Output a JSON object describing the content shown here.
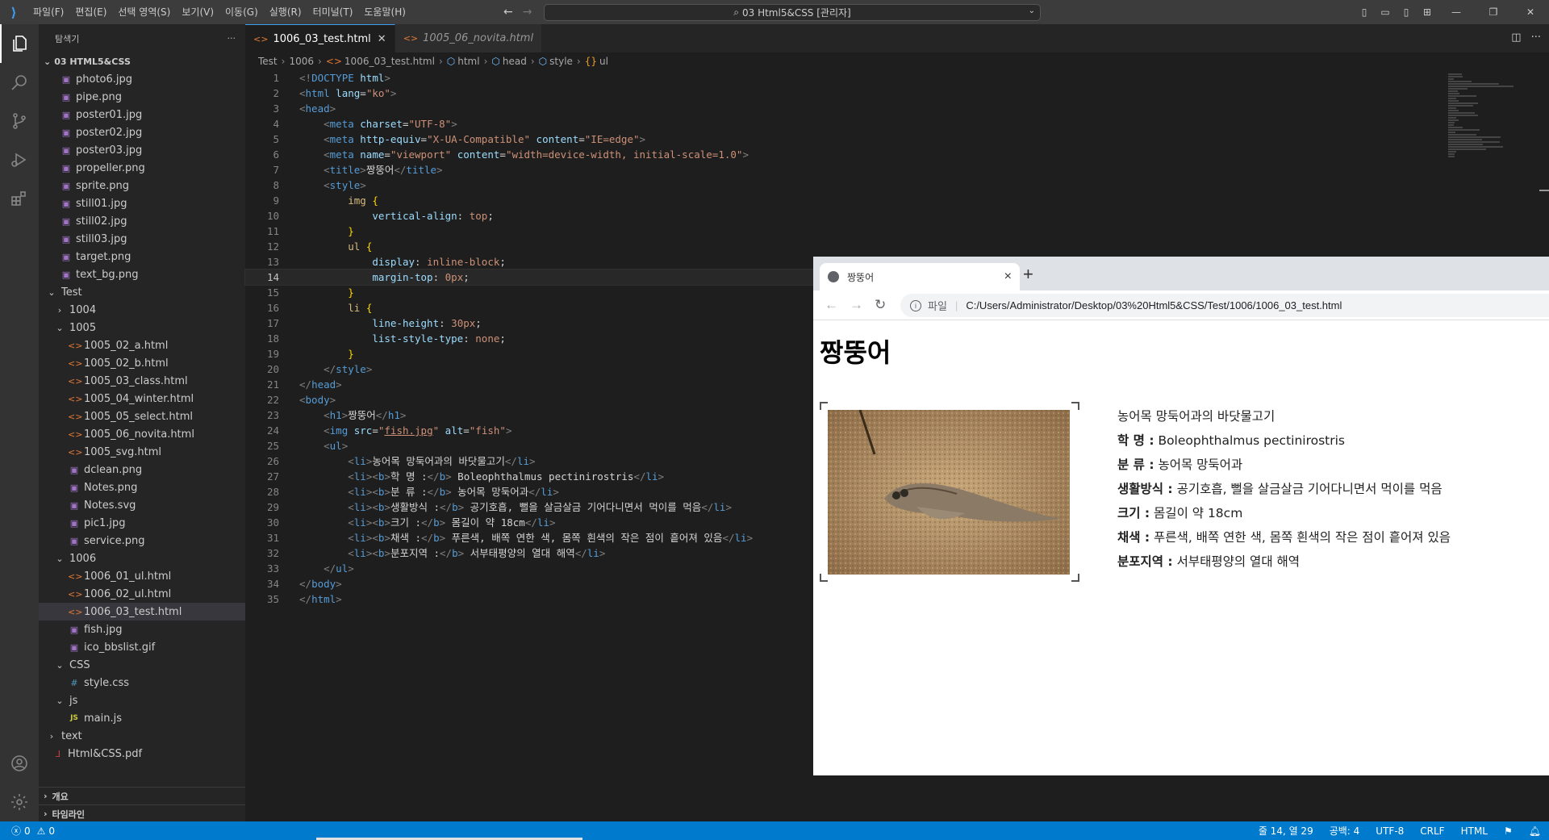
{
  "titlebar": {
    "menus": [
      "파일(F)",
      "편집(E)",
      "선택 영역(S)",
      "보기(V)",
      "이동(G)",
      "실행(R)",
      "터미널(T)",
      "도움말(H)"
    ],
    "command_center": "03 Html5&CSS [관리자]"
  },
  "explorer": {
    "title": "탐색기",
    "root": "03 HTML5&CSS",
    "items": [
      {
        "label": "photo6.jpg",
        "icon": "image",
        "indent": 1
      },
      {
        "label": "pipe.png",
        "icon": "image",
        "indent": 1
      },
      {
        "label": "poster01.jpg",
        "icon": "image",
        "indent": 1
      },
      {
        "label": "poster02.jpg",
        "icon": "image",
        "indent": 1
      },
      {
        "label": "poster03.jpg",
        "icon": "image",
        "indent": 1
      },
      {
        "label": "propeller.png",
        "icon": "image",
        "indent": 1
      },
      {
        "label": "sprite.png",
        "icon": "image",
        "indent": 1
      },
      {
        "label": "still01.jpg",
        "icon": "image",
        "indent": 1
      },
      {
        "label": "still02.jpg",
        "icon": "image",
        "indent": 1
      },
      {
        "label": "still03.jpg",
        "icon": "image",
        "indent": 1
      },
      {
        "label": "target.png",
        "icon": "image",
        "indent": 1
      },
      {
        "label": "text_bg.png",
        "icon": "image",
        "indent": 1
      },
      {
        "label": "Test",
        "icon": "chevron-down",
        "indent": 0
      },
      {
        "label": "1004",
        "icon": "chevron-right",
        "indent": 1
      },
      {
        "label": "1005",
        "icon": "chevron-down",
        "indent": 1
      },
      {
        "label": "1005_02_a.html",
        "icon": "html",
        "indent": 2
      },
      {
        "label": "1005_02_b.html",
        "icon": "html",
        "indent": 2
      },
      {
        "label": "1005_03_class.html",
        "icon": "html",
        "indent": 2
      },
      {
        "label": "1005_04_winter.html",
        "icon": "html",
        "indent": 2
      },
      {
        "label": "1005_05_select.html",
        "icon": "html",
        "indent": 2
      },
      {
        "label": "1005_06_novita.html",
        "icon": "html",
        "indent": 2
      },
      {
        "label": "1005_svg.html",
        "icon": "html",
        "indent": 2
      },
      {
        "label": "dclean.png",
        "icon": "image",
        "indent": 2
      },
      {
        "label": "Notes.png",
        "icon": "image",
        "indent": 2
      },
      {
        "label": "Notes.svg",
        "icon": "image",
        "indent": 2
      },
      {
        "label": "pic1.jpg",
        "icon": "image",
        "indent": 2
      },
      {
        "label": "service.png",
        "icon": "image",
        "indent": 2
      },
      {
        "label": "1006",
        "icon": "chevron-down",
        "indent": 1
      },
      {
        "label": "1006_01_ul.html",
        "icon": "html",
        "indent": 2
      },
      {
        "label": "1006_02_ul.html",
        "icon": "html",
        "indent": 2
      },
      {
        "label": "1006_03_test.html",
        "icon": "html",
        "indent": 2,
        "selected": true
      },
      {
        "label": "fish.jpg",
        "icon": "image",
        "indent": 2
      },
      {
        "label": "ico_bbslist.gif",
        "icon": "image",
        "indent": 2
      },
      {
        "label": "CSS",
        "icon": "chevron-down",
        "indent": 1
      },
      {
        "label": "style.css",
        "icon": "css",
        "indent": 2
      },
      {
        "label": "js",
        "icon": "chevron-down",
        "indent": 1
      },
      {
        "label": "main.js",
        "icon": "js",
        "indent": 2
      },
      {
        "label": "text",
        "icon": "chevron-right",
        "indent": 0
      },
      {
        "label": "Html&CSS.pdf",
        "icon": "pdf",
        "indent": 0
      }
    ],
    "outline": "개요",
    "timeline": "타임라인"
  },
  "tabs": [
    {
      "label": "1006_03_test.html",
      "active": true
    },
    {
      "label": "1005_06_novita.html",
      "active": false
    }
  ],
  "breadcrumb": [
    "Test",
    "1006",
    "1006_03_test.html",
    "html",
    "head",
    "style",
    "ul"
  ],
  "editor": {
    "current_line": 14,
    "lines": [
      [
        [
          "p",
          "<!"
        ],
        [
          "t",
          "DOCTYPE"
        ],
        [
          "x",
          " "
        ],
        [
          "a",
          "html"
        ],
        [
          "p",
          ">"
        ]
      ],
      [
        [
          "p",
          "<"
        ],
        [
          "t",
          "html"
        ],
        [
          "x",
          " "
        ],
        [
          "a",
          "lang"
        ],
        [
          "x",
          "="
        ],
        [
          "s",
          "\"ko\""
        ],
        [
          "p",
          ">"
        ]
      ],
      [
        [
          "p",
          "<"
        ],
        [
          "t",
          "head"
        ],
        [
          "p",
          ">"
        ]
      ],
      [
        [
          "x",
          "    "
        ],
        [
          "p",
          "<"
        ],
        [
          "t",
          "meta"
        ],
        [
          "x",
          " "
        ],
        [
          "a",
          "charset"
        ],
        [
          "x",
          "="
        ],
        [
          "s",
          "\"UTF-8\""
        ],
        [
          "p",
          ">"
        ]
      ],
      [
        [
          "x",
          "    "
        ],
        [
          "p",
          "<"
        ],
        [
          "t",
          "meta"
        ],
        [
          "x",
          " "
        ],
        [
          "a",
          "http-equiv"
        ],
        [
          "x",
          "="
        ],
        [
          "s",
          "\"X-UA-Compatible\""
        ],
        [
          "x",
          " "
        ],
        [
          "a",
          "content"
        ],
        [
          "x",
          "="
        ],
        [
          "s",
          "\"IE=edge\""
        ],
        [
          "p",
          ">"
        ]
      ],
      [
        [
          "x",
          "    "
        ],
        [
          "p",
          "<"
        ],
        [
          "t",
          "meta"
        ],
        [
          "x",
          " "
        ],
        [
          "a",
          "name"
        ],
        [
          "x",
          "="
        ],
        [
          "s",
          "\"viewport\""
        ],
        [
          "x",
          " "
        ],
        [
          "a",
          "content"
        ],
        [
          "x",
          "="
        ],
        [
          "s",
          "\"width=device-width, initial-scale=1.0\""
        ],
        [
          "p",
          ">"
        ]
      ],
      [
        [
          "x",
          "    "
        ],
        [
          "p",
          "<"
        ],
        [
          "t",
          "title"
        ],
        [
          "p",
          ">"
        ],
        [
          "x",
          "짱뚱어"
        ],
        [
          "p",
          "</"
        ],
        [
          "t",
          "title"
        ],
        [
          "p",
          ">"
        ]
      ],
      [
        [
          "x",
          "    "
        ],
        [
          "p",
          "<"
        ],
        [
          "t",
          "style"
        ],
        [
          "p",
          ">"
        ]
      ],
      [
        [
          "x",
          "        "
        ],
        [
          "sel",
          "img"
        ],
        [
          "x",
          " "
        ],
        [
          "y",
          "{"
        ]
      ],
      [
        [
          "x",
          "            "
        ],
        [
          "a",
          "vertical-align"
        ],
        [
          "x",
          ": "
        ],
        [
          "s",
          "top"
        ],
        [
          "x",
          ";"
        ]
      ],
      [
        [
          "x",
          "        "
        ],
        [
          "y",
          "}"
        ]
      ],
      [
        [
          "x",
          "        "
        ],
        [
          "sel",
          "ul"
        ],
        [
          "x",
          " "
        ],
        [
          "y",
          "{"
        ]
      ],
      [
        [
          "x",
          "            "
        ],
        [
          "a",
          "display"
        ],
        [
          "x",
          ": "
        ],
        [
          "s",
          "inline-block"
        ],
        [
          "x",
          ";"
        ]
      ],
      [
        [
          "x",
          "            "
        ],
        [
          "a",
          "margin-top"
        ],
        [
          "x",
          ": "
        ],
        [
          "s",
          "0px"
        ],
        [
          "x",
          ";"
        ]
      ],
      [
        [
          "x",
          "        "
        ],
        [
          "y",
          "}"
        ]
      ],
      [
        [
          "x",
          "        "
        ],
        [
          "sel",
          "li"
        ],
        [
          "x",
          " "
        ],
        [
          "y",
          "{"
        ]
      ],
      [
        [
          "x",
          "            "
        ],
        [
          "a",
          "line-height"
        ],
        [
          "x",
          ": "
        ],
        [
          "s",
          "30px"
        ],
        [
          "x",
          ";"
        ]
      ],
      [
        [
          "x",
          "            "
        ],
        [
          "a",
          "list-style-type"
        ],
        [
          "x",
          ": "
        ],
        [
          "s",
          "none"
        ],
        [
          "x",
          ";"
        ]
      ],
      [
        [
          "x",
          "        "
        ],
        [
          "y",
          "}"
        ]
      ],
      [
        [
          "x",
          "    "
        ],
        [
          "p",
          "</"
        ],
        [
          "t",
          "style"
        ],
        [
          "p",
          ">"
        ]
      ],
      [
        [
          "p",
          "</"
        ],
        [
          "t",
          "head"
        ],
        [
          "p",
          ">"
        ]
      ],
      [
        [
          "p",
          "<"
        ],
        [
          "t",
          "body"
        ],
        [
          "p",
          ">"
        ]
      ],
      [
        [
          "x",
          "    "
        ],
        [
          "p",
          "<"
        ],
        [
          "t",
          "h1"
        ],
        [
          "p",
          ">"
        ],
        [
          "x",
          "짱뚱어"
        ],
        [
          "p",
          "</"
        ],
        [
          "t",
          "h1"
        ],
        [
          "p",
          ">"
        ]
      ],
      [
        [
          "x",
          "    "
        ],
        [
          "p",
          "<"
        ],
        [
          "t",
          "img"
        ],
        [
          "x",
          " "
        ],
        [
          "a",
          "src"
        ],
        [
          "x",
          "="
        ],
        [
          "s",
          "\""
        ],
        [
          "su",
          "fish.jpg"
        ],
        [
          "s",
          "\""
        ],
        [
          "x",
          " "
        ],
        [
          "a",
          "alt"
        ],
        [
          "x",
          "="
        ],
        [
          "s",
          "\"fish\""
        ],
        [
          "p",
          ">"
        ]
      ],
      [
        [
          "x",
          "    "
        ],
        [
          "p",
          "<"
        ],
        [
          "t",
          "ul"
        ],
        [
          "p",
          ">"
        ]
      ],
      [
        [
          "x",
          "        "
        ],
        [
          "p",
          "<"
        ],
        [
          "t",
          "li"
        ],
        [
          "p",
          ">"
        ],
        [
          "x",
          "농어목 망둑어과의 바닷물고기"
        ],
        [
          "p",
          "</"
        ],
        [
          "t",
          "li"
        ],
        [
          "p",
          ">"
        ]
      ],
      [
        [
          "x",
          "        "
        ],
        [
          "p",
          "<"
        ],
        [
          "t",
          "li"
        ],
        [
          "p",
          "><"
        ],
        [
          "t",
          "b"
        ],
        [
          "p",
          ">"
        ],
        [
          "x",
          "학 명 :"
        ],
        [
          "p",
          "</"
        ],
        [
          "t",
          "b"
        ],
        [
          "p",
          ">"
        ],
        [
          "x",
          " Boleophthalmus pectinirostris"
        ],
        [
          "p",
          "</"
        ],
        [
          "t",
          "li"
        ],
        [
          "p",
          ">"
        ]
      ],
      [
        [
          "x",
          "        "
        ],
        [
          "p",
          "<"
        ],
        [
          "t",
          "li"
        ],
        [
          "p",
          "><"
        ],
        [
          "t",
          "b"
        ],
        [
          "p",
          ">"
        ],
        [
          "x",
          "분 류 :"
        ],
        [
          "p",
          "</"
        ],
        [
          "t",
          "b"
        ],
        [
          "p",
          ">"
        ],
        [
          "x",
          " 농어목 망둑어과"
        ],
        [
          "p",
          "</"
        ],
        [
          "t",
          "li"
        ],
        [
          "p",
          ">"
        ]
      ],
      [
        [
          "x",
          "        "
        ],
        [
          "p",
          "<"
        ],
        [
          "t",
          "li"
        ],
        [
          "p",
          "><"
        ],
        [
          "t",
          "b"
        ],
        [
          "p",
          ">"
        ],
        [
          "x",
          "생활방식 :"
        ],
        [
          "p",
          "</"
        ],
        [
          "t",
          "b"
        ],
        [
          "p",
          ">"
        ],
        [
          "x",
          " 공기호흡, 뻘을 살금살금 기어다니면서 먹이를 먹음"
        ],
        [
          "p",
          "</"
        ],
        [
          "t",
          "li"
        ],
        [
          "p",
          ">"
        ]
      ],
      [
        [
          "x",
          "        "
        ],
        [
          "p",
          "<"
        ],
        [
          "t",
          "li"
        ],
        [
          "p",
          "><"
        ],
        [
          "t",
          "b"
        ],
        [
          "p",
          ">"
        ],
        [
          "x",
          "크기 :"
        ],
        [
          "p",
          "</"
        ],
        [
          "t",
          "b"
        ],
        [
          "p",
          ">"
        ],
        [
          "x",
          " 몸길이 약 18cm"
        ],
        [
          "p",
          "</"
        ],
        [
          "t",
          "li"
        ],
        [
          "p",
          ">"
        ]
      ],
      [
        [
          "x",
          "        "
        ],
        [
          "p",
          "<"
        ],
        [
          "t",
          "li"
        ],
        [
          "p",
          "><"
        ],
        [
          "t",
          "b"
        ],
        [
          "p",
          ">"
        ],
        [
          "x",
          "채색 :"
        ],
        [
          "p",
          "</"
        ],
        [
          "t",
          "b"
        ],
        [
          "p",
          ">"
        ],
        [
          "x",
          " 푸른색, 배쪽 연한 색, 몸쪽 흰색의 작은 점이 흩어져 있음"
        ],
        [
          "p",
          "</"
        ],
        [
          "t",
          "li"
        ],
        [
          "p",
          ">"
        ]
      ],
      [
        [
          "x",
          "        "
        ],
        [
          "p",
          "<"
        ],
        [
          "t",
          "li"
        ],
        [
          "p",
          "><"
        ],
        [
          "t",
          "b"
        ],
        [
          "p",
          ">"
        ],
        [
          "x",
          "분포지역 :"
        ],
        [
          "p",
          "</"
        ],
        [
          "t",
          "b"
        ],
        [
          "p",
          ">"
        ],
        [
          "x",
          " 서부태평양의 열대 해역"
        ],
        [
          "p",
          "</"
        ],
        [
          "t",
          "li"
        ],
        [
          "p",
          ">"
        ]
      ],
      [
        [
          "x",
          "    "
        ],
        [
          "p",
          "</"
        ],
        [
          "t",
          "ul"
        ],
        [
          "p",
          ">"
        ]
      ],
      [
        [
          "p",
          "</"
        ],
        [
          "t",
          "body"
        ],
        [
          "p",
          ">"
        ]
      ],
      [
        [
          "p",
          "</"
        ],
        [
          "t",
          "html"
        ],
        [
          "p",
          ">"
        ]
      ]
    ]
  },
  "browser": {
    "tab_title": "짱뚱어",
    "address_label": "파일",
    "url": "C:/Users/Administrator/Desktop/03%20Html5&CSS/Test/1006/1006_03_test.html",
    "heading": "짱뚱어",
    "image_alt": "fish",
    "list": [
      {
        "b": "",
        "t": "농어목 망둑어과의 바닷물고기"
      },
      {
        "b": "학 명 :",
        "t": " Boleophthalmus pectinirostris"
      },
      {
        "b": "분 류 :",
        "t": " 농어목 망둑어과"
      },
      {
        "b": "생활방식 :",
        "t": " 공기호흡, 뻘을 살금살금 기어다니면서 먹이를 먹음"
      },
      {
        "b": "크기 :",
        "t": " 몸길이 약 18cm"
      },
      {
        "b": "채색 :",
        "t": " 푸른색, 배쪽 연한 색, 몸쪽 흰색의 작은 점이 흩어져 있음"
      },
      {
        "b": "분포지역 :",
        "t": " 서부태평양의 열대 해역"
      }
    ]
  },
  "statusbar": {
    "errors": "0",
    "warnings": "0",
    "position": "줄 14, 열 29",
    "spaces": "공백: 4",
    "encoding": "UTF-8",
    "eol": "CRLF",
    "language": "HTML"
  },
  "colors": {
    "accent": "#007acc",
    "editor_bg": "#1e1e1e",
    "sidebar_bg": "#252526"
  }
}
